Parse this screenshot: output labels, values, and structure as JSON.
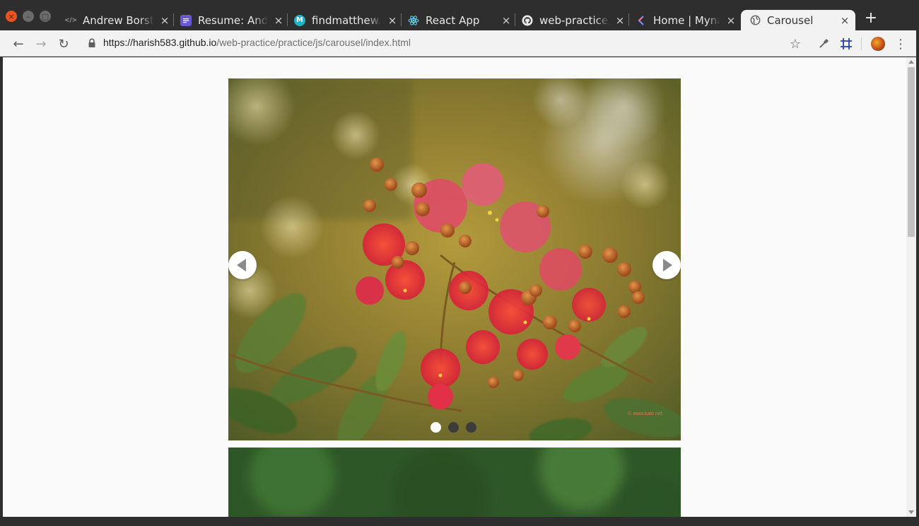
{
  "window": {
    "close_glyph": "×",
    "minimize_glyph": "–",
    "maximize_glyph": "□"
  },
  "tabs": [
    {
      "label": "Andrew Borstein",
      "favicon": "code-icon",
      "active": false
    },
    {
      "label": "Resume: Andrew Borstein",
      "favicon": "docs-icon",
      "active": false
    },
    {
      "label": "findmatthew.com",
      "favicon": "m-logo-icon",
      "active": false
    },
    {
      "label": "React App",
      "favicon": "react-icon",
      "active": false
    },
    {
      "label": "web-practice/practice",
      "favicon": "github-icon",
      "active": false
    },
    {
      "label": "Home | Mynaui",
      "favicon": "brand-icon",
      "active": false
    },
    {
      "label": "Carousel",
      "favicon": "globe-icon",
      "active": true
    }
  ],
  "tab_close_glyph": "×",
  "new_tab_glyph": "+",
  "toolbar": {
    "back_glyph": "←",
    "forward_glyph": "→",
    "reload_glyph": "↻",
    "url_host": "https://harish583.github.io",
    "url_path": "/web-practice/practice/js/carousel/index.html",
    "bookmark_glyph": "☆",
    "eyedropper_glyph": "✎",
    "grid_glyph": "#",
    "menu_glyph": "⋮"
  },
  "carousel": {
    "current_slide": 1,
    "slide_count": 3,
    "watermark": "© www.kate.net",
    "colors": {
      "arrow_bg": "#ffffff",
      "arrow_icon": "#8a8a8a",
      "dot_active": "#ffffff",
      "dot_inactive": "#3c3c3c"
    }
  }
}
